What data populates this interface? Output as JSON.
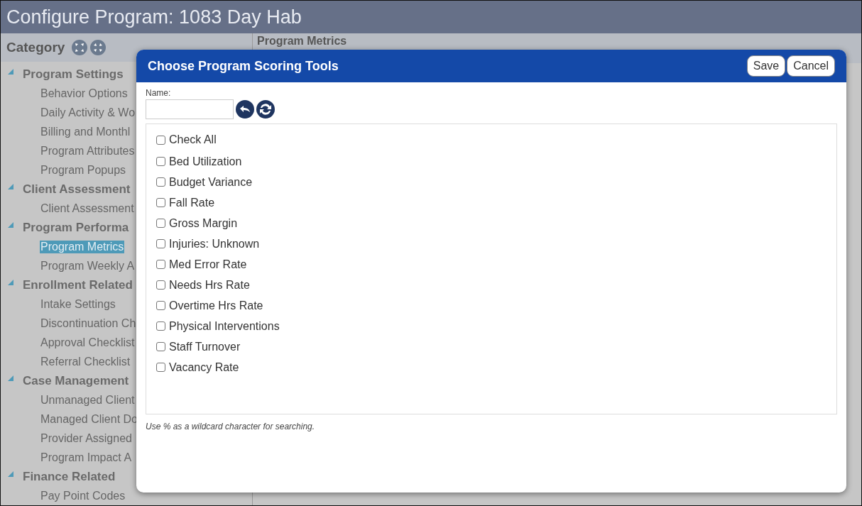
{
  "window": {
    "title": "Configure Program: 1083 Day Hab"
  },
  "sidebar": {
    "heading": "Category",
    "groups": [
      {
        "label": "Program Settings",
        "expanded": true,
        "children": [
          {
            "label": "Behavior Options",
            "selected": false
          },
          {
            "label": "Daily Activity & Wo",
            "selected": false
          },
          {
            "label": "Billing and Monthl",
            "selected": false
          },
          {
            "label": "Program Attributes",
            "selected": false
          },
          {
            "label": "Program Popups",
            "selected": false
          }
        ]
      },
      {
        "label": "Client Assessment",
        "expanded": true,
        "children": [
          {
            "label": "Client Assessment",
            "selected": false
          }
        ]
      },
      {
        "label": "Program Performa",
        "expanded": true,
        "children": [
          {
            "label": "Program Metrics",
            "selected": true
          },
          {
            "label": "Program Weekly A",
            "selected": false
          }
        ]
      },
      {
        "label": "Enrollment Related",
        "expanded": true,
        "children": [
          {
            "label": "Intake Settings",
            "selected": false
          },
          {
            "label": "Discontinuation Ch",
            "selected": false
          },
          {
            "label": "Approval Checklist",
            "selected": false
          },
          {
            "label": "Referral Checklist",
            "selected": false
          }
        ]
      },
      {
        "label": "Case Management",
        "expanded": true,
        "children": [
          {
            "label": "Unmanaged Client",
            "selected": false
          },
          {
            "label": "Managed Client Do",
            "selected": false
          },
          {
            "label": "Provider Assigned",
            "selected": false
          },
          {
            "label": "Program Impact A",
            "selected": false
          }
        ]
      },
      {
        "label": "Finance Related",
        "expanded": true,
        "children": [
          {
            "label": "Pay Point Codes",
            "selected": false
          }
        ]
      }
    ]
  },
  "content": {
    "heading": "Program Metrics"
  },
  "dialog": {
    "title": "Choose Program Scoring Tools",
    "buttons": [
      "Save",
      "Cancel"
    ],
    "name_field": {
      "label": "Name:"
    },
    "check_all": {
      "label": "Check All",
      "checked": false
    },
    "options": [
      {
        "label": "Bed Utilization",
        "checked": false
      },
      {
        "label": "Budget Variance",
        "checked": false
      },
      {
        "label": "Fall Rate",
        "checked": false
      },
      {
        "label": "Gross Margin",
        "checked": false
      },
      {
        "label": "Injuries: Unknown",
        "checked": false
      },
      {
        "label": "Med Error Rate",
        "checked": false
      },
      {
        "label": "Needs Hrs Rate",
        "checked": false
      },
      {
        "label": "Overtime Hrs Rate",
        "checked": false
      },
      {
        "label": "Physical Interventions",
        "checked": false
      },
      {
        "label": "Staff Turnover",
        "checked": false
      },
      {
        "label": "Vacancy Rate",
        "checked": false
      }
    ],
    "hint": "Use % as a wildcard character for searching."
  }
}
